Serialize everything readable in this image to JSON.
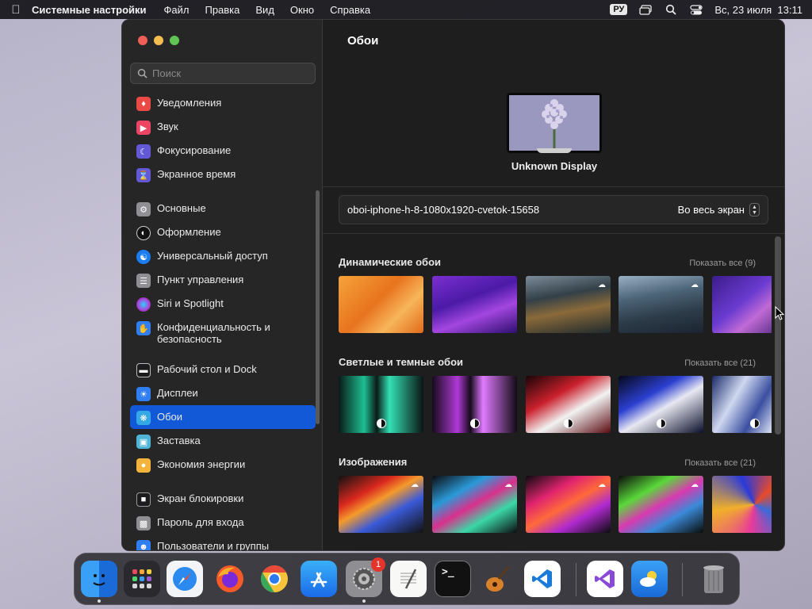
{
  "menubar": {
    "app_name": "Системные настройки",
    "menus": [
      "Файл",
      "Правка",
      "Вид",
      "Окно",
      "Справка"
    ],
    "input_source": "РУ",
    "datetime": "Вс, 23 июля  13:11"
  },
  "sidebar": {
    "search_placeholder": "Поиск",
    "items": [
      {
        "label": "Уведомления",
        "icon": "bell-icon",
        "color": "#ea4a45"
      },
      {
        "label": "Звук",
        "icon": "speaker-icon",
        "color": "#eb4563"
      },
      {
        "label": "Фокусирование",
        "icon": "moon-icon",
        "color": "#6358d6"
      },
      {
        "label": "Экранное время",
        "icon": "hourglass-icon",
        "color": "#6358d6"
      },
      {
        "label": "Основные",
        "icon": "gear-icon",
        "color": "#8e8e93"
      },
      {
        "label": "Оформление",
        "icon": "appearance-icon",
        "color": "#111111"
      },
      {
        "label": "Универсальный доступ",
        "icon": "accessibility-icon",
        "color": "#1a7ef2"
      },
      {
        "label": "Пункт управления",
        "icon": "control-center-icon",
        "color": "#8e8e93"
      },
      {
        "label": "Siri и Spotlight",
        "icon": "siri-icon",
        "color": "#b13bd6"
      },
      {
        "label": "Конфиденциальность и безопасность",
        "icon": "hand-icon",
        "color": "#2f7ef2"
      },
      {
        "label": "Рабочий стол и Dock",
        "icon": "dock-icon",
        "color": "#1c1c1e"
      },
      {
        "label": "Дисплеи",
        "icon": "sun-icon",
        "color": "#2f7ef2"
      },
      {
        "label": "Обои",
        "icon": "wallpaper-icon",
        "color": "#35a9e6"
      },
      {
        "label": "Заставка",
        "icon": "screensaver-icon",
        "color": "#4fb5d6"
      },
      {
        "label": "Экономия энергии",
        "icon": "bulb-icon",
        "color": "#f4b33a"
      },
      {
        "label": "Экран блокировки",
        "icon": "lock-icon",
        "color": "#1c1c1e"
      },
      {
        "label": "Пароль для входа",
        "icon": "padlock-icon",
        "color": "#8e8e93"
      },
      {
        "label": "Пользователи и группы",
        "icon": "users-icon",
        "color": "#2f7ef2"
      }
    ]
  },
  "main": {
    "title": "Обои",
    "display_name": "Unknown Display",
    "wallpaper_name": "oboi-iphone-h-8-1080x1920-cvetok-15658",
    "fit_mode": "Во весь экран",
    "sections": [
      {
        "title": "Динамические обои",
        "show_all": "Показать все (9)"
      },
      {
        "title": "Светлые и темные обои",
        "show_all": "Показать все (21)"
      },
      {
        "title": "Изображения",
        "show_all": "Показать все (21)"
      }
    ]
  },
  "dock": {
    "apps": [
      "finder-icon",
      "launchpad-icon",
      "safari-icon",
      "firefox-icon",
      "chrome-icon",
      "app-store-icon",
      "system-settings-icon",
      "textedit-icon",
      "terminal-icon",
      "garageband-icon",
      "vscode-icon",
      "visual-studio-icon",
      "weather-icon",
      "trash-icon"
    ],
    "settings_badge": "1"
  },
  "colors": {
    "accent": "#1259d8",
    "window_bg": "#1e1e1e",
    "sidebar_bg": "#262626"
  }
}
